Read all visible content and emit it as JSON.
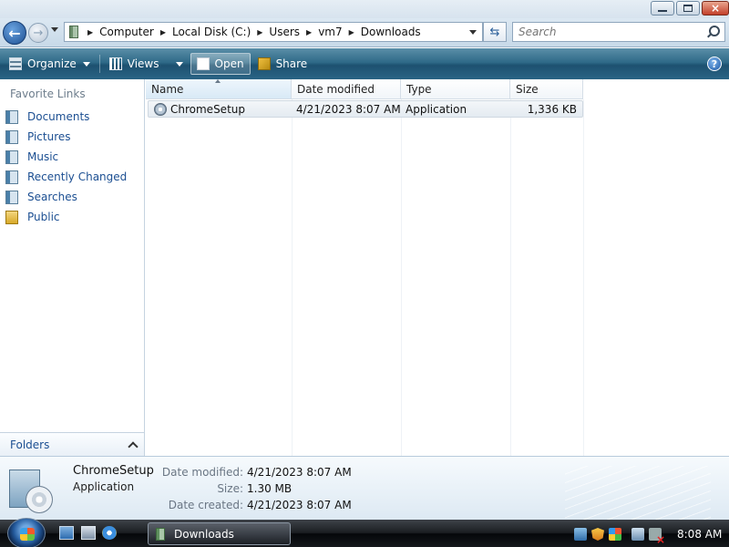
{
  "window": {
    "address_crumbs": [
      "Computer",
      "Local Disk (C:)",
      "Users",
      "vm7",
      "Downloads"
    ],
    "search_placeholder": "Search"
  },
  "toolbar": {
    "organize_label": "Organize",
    "views_label": "Views",
    "open_label": "Open",
    "share_label": "Share",
    "help_label": "?"
  },
  "navpane": {
    "favorites_title": "Favorite Links",
    "items": [
      {
        "label": "Documents",
        "icon": "documents-icon"
      },
      {
        "label": "Pictures",
        "icon": "pictures-icon"
      },
      {
        "label": "Music",
        "icon": "music-icon"
      },
      {
        "label": "Recently Changed",
        "icon": "recently-changed-icon"
      },
      {
        "label": "Searches",
        "icon": "searches-icon"
      },
      {
        "label": "Public",
        "icon": "folder-icon"
      }
    ],
    "folders_label": "Folders"
  },
  "filelist": {
    "columns": [
      "Name",
      "Date modified",
      "Type",
      "Size"
    ],
    "rows": [
      {
        "name": "ChromeSetup",
        "date_modified": "4/21/2023 8:07 AM",
        "type": "Application",
        "size": "1,336 KB"
      }
    ]
  },
  "details": {
    "name": "ChromeSetup",
    "type": "Application",
    "fields": [
      {
        "label": "Date modified:",
        "value": "4/21/2023 8:07 AM"
      },
      {
        "label": "Size:",
        "value": "1.30 MB"
      },
      {
        "label": "Date created:",
        "value": "4/21/2023 8:07 AM"
      }
    ]
  },
  "taskbar": {
    "active_task_label": "Downloads",
    "clock": "8:08 AM"
  },
  "colors": {
    "link_blue": "#1c4f92",
    "toolbar_teal": "#2f6a88"
  }
}
